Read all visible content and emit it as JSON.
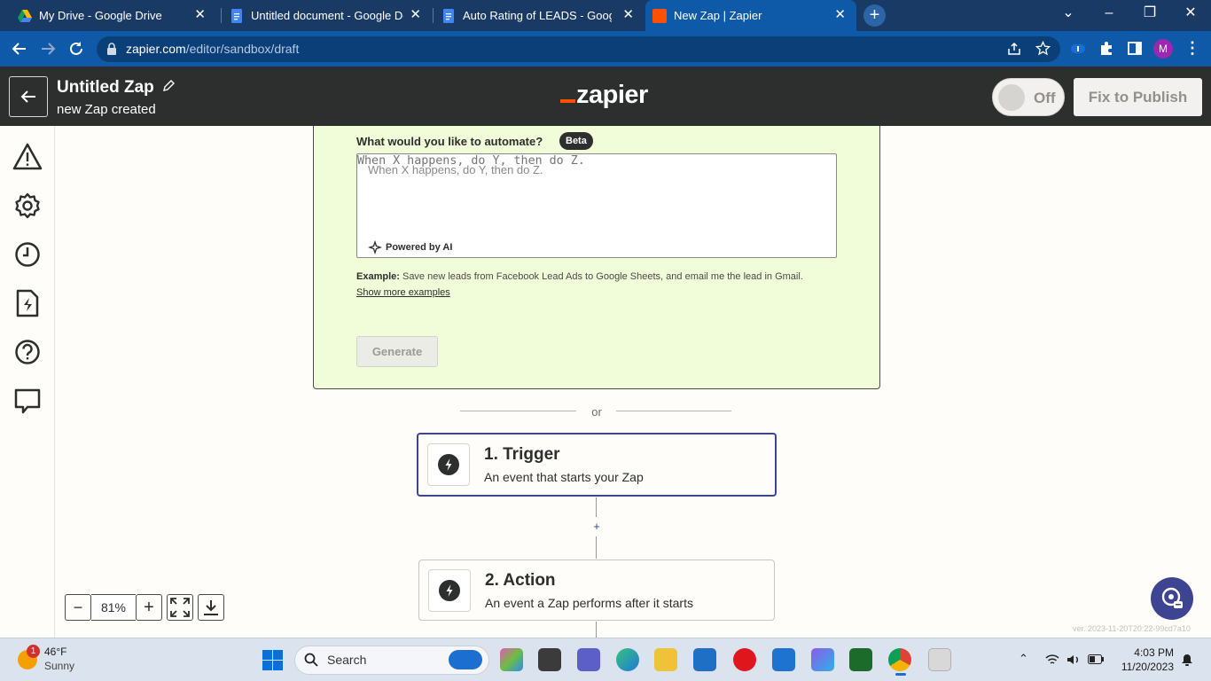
{
  "browser": {
    "tabs": [
      {
        "title": "My Drive - Google Drive",
        "close": "✕"
      },
      {
        "title": "Untitled document - Google Docs",
        "close": "✕"
      },
      {
        "title": "Auto Rating of LEADS - Google Docs",
        "close": "✕"
      },
      {
        "title": "New Zap | Zapier",
        "close": "✕"
      }
    ],
    "new_tab": "+",
    "url_host": "zapier.com",
    "url_path": "/editor/sandbox/draft",
    "profile_initial": "M"
  },
  "zap_header": {
    "title": "Untitled Zap",
    "subtitle": "new Zap created",
    "logo": "zapier",
    "toggle_label": "Off",
    "publish_label": "Fix to Publish"
  },
  "ai_card": {
    "question": "What would you like to automate?",
    "badge": "Beta",
    "placeholder": "When X happens, do Y, then do Z.",
    "powered": "Powered by AI",
    "example_label": "Example:",
    "example_text": " Save new leads from Facebook Lead Ads to Google Sheets, and email me the lead in Gmail.",
    "show_more": "Show more examples",
    "generate": "Generate"
  },
  "divider_text": "or",
  "steps": [
    {
      "title": "1. Trigger",
      "desc": "An event that starts your Zap"
    },
    {
      "title": "2. Action",
      "desc": "An event a Zap performs after it starts"
    }
  ],
  "add_step": "+",
  "zoom": {
    "minus": "−",
    "value": "81%",
    "plus": "+"
  },
  "version": "ver. 2023-11-20T20:22-99cd7a10",
  "taskbar": {
    "weather_temp": "46°F",
    "weather_desc": "Sunny",
    "weather_badge": "1",
    "search": "Search",
    "time": "4:03 PM",
    "date": "11/20/2023"
  },
  "colors": {
    "tabbar": "#1a3a66",
    "toolbar": "#0f5aa8",
    "zap_header": "#2d2e2e",
    "zapier_orange": "#ff4f00",
    "card_bg": "#f1fcd9",
    "trigger_border": "#3d4592"
  }
}
